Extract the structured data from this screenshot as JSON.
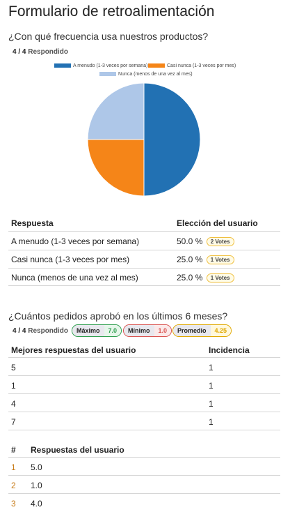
{
  "page": {
    "title": "Formulario de retroalimentación"
  },
  "question1": {
    "title": "¿Con qué frecuencia usa nuestros productos?",
    "answered_count": "4 / 4",
    "answered_label": "Respondido",
    "legend": [
      {
        "label": "A menudo (1-3 veces por semana)",
        "color": "#2271b3"
      },
      {
        "label": "Casi nunca (1-3 veces por mes)",
        "color": "#f58518"
      },
      {
        "label": "Nunca (menos de una vez al mes)",
        "color": "#aec7e8"
      }
    ],
    "chart_data": {
      "type": "pie",
      "slices": [
        {
          "label": "A menudo (1-3 veces por semana)",
          "value": 50.0,
          "color": "#2271b3"
        },
        {
          "label": "Casi nunca (1-3 veces por mes)",
          "value": 25.0,
          "color": "#f58518"
        },
        {
          "label": "Nunca (menos de una vez al mes)",
          "value": 25.0,
          "color": "#aec7e8"
        }
      ]
    },
    "table": {
      "headers": [
        "Respuesta",
        "Elección del usuario"
      ],
      "rows": [
        {
          "answer": "A menudo (1-3 veces por semana)",
          "percent": "50.0 %",
          "votes": "2 Votes"
        },
        {
          "answer": "Casi nunca (1-3 veces por mes)",
          "percent": "25.0 %",
          "votes": "1 Votes"
        },
        {
          "answer": "Nunca (menos de una vez al mes)",
          "percent": "25.0 %",
          "votes": "1 Votes"
        }
      ]
    }
  },
  "question2": {
    "title": "¿Cuántos pedidos aprobó en los últimos 6 meses?",
    "answered_count": "4 / 4",
    "answered_label": "Respondido",
    "stats": {
      "max_label": "Máximo",
      "max_value": "7.0",
      "max_color": "#2e9e4d",
      "min_label": "Mínimo",
      "min_value": "1.0",
      "min_color": "#d9534f",
      "avg_label": "Promedio",
      "avg_value": "4.25",
      "avg_color": "#e0a800"
    },
    "top_table": {
      "headers": [
        "Mejores respuestas del usuario",
        "Incidencia"
      ],
      "rows": [
        {
          "answer": "5",
          "count": "1"
        },
        {
          "answer": "1",
          "count": "1"
        },
        {
          "answer": "4",
          "count": "1"
        },
        {
          "answer": "7",
          "count": "1"
        }
      ]
    },
    "responses_table": {
      "headers": [
        "#",
        "Respuestas del usuario"
      ],
      "rows": [
        {
          "index": "1",
          "value": "5.0"
        },
        {
          "index": "2",
          "value": "1.0"
        },
        {
          "index": "3",
          "value": "4.0"
        }
      ]
    }
  }
}
